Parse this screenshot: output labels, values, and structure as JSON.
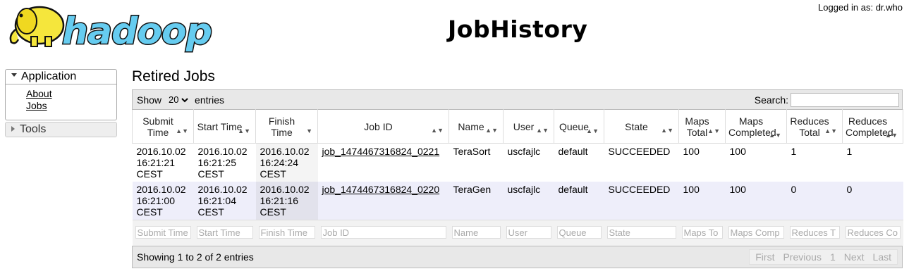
{
  "header": {
    "login_text": "Logged in as: dr.who",
    "page_title": "JobHistory",
    "logo_alt": "hadoop"
  },
  "sidebar": {
    "application_label": "Application",
    "links": [
      "About",
      "Jobs"
    ],
    "tools_label": "Tools"
  },
  "main": {
    "section_title": "Retired Jobs",
    "show_label": "Show",
    "entries_value": "20",
    "entries_label": "entries",
    "search_label": "Search:",
    "columns": [
      "Submit Time",
      "Start Time",
      "Finish Time",
      "Job ID",
      "Name",
      "User",
      "Queue",
      "State",
      "Maps Total",
      "Maps Completed",
      "Reduces Total",
      "Reduces Completed"
    ],
    "rows": [
      {
        "submit": "2016.10.02 16:21:21 CEST",
        "start": "2016.10.02 16:21:25 CEST",
        "finish": "2016.10.02 16:24:24 CEST",
        "job_id": "job_1474467316824_0221",
        "name": "TeraSort",
        "user": "uscfajlc",
        "queue": "default",
        "state": "SUCCEEDED",
        "maps_total": "100",
        "maps_completed": "100",
        "reduces_total": "1",
        "reduces_completed": "1"
      },
      {
        "submit": "2016.10.02 16:21:00 CEST",
        "start": "2016.10.02 16:21:04 CEST",
        "finish": "2016.10.02 16:21:16 CEST",
        "job_id": "job_1474467316824_0220",
        "name": "TeraGen",
        "user": "uscfajlc",
        "queue": "default",
        "state": "SUCCEEDED",
        "maps_total": "100",
        "maps_completed": "100",
        "reduces_total": "0",
        "reduces_completed": "0"
      }
    ],
    "filters": [
      "Submit Time",
      "Start Time",
      "Finish Time",
      "Job ID",
      "Name",
      "User",
      "Queue",
      "State",
      "Maps To",
      "Maps Comp",
      "Reduces T",
      "Reduces Co"
    ],
    "info_text": "Showing 1 to 2 of 2 entries",
    "pager": {
      "first": "First",
      "previous": "Previous",
      "page": "1",
      "next": "Next",
      "last": "Last"
    }
  }
}
